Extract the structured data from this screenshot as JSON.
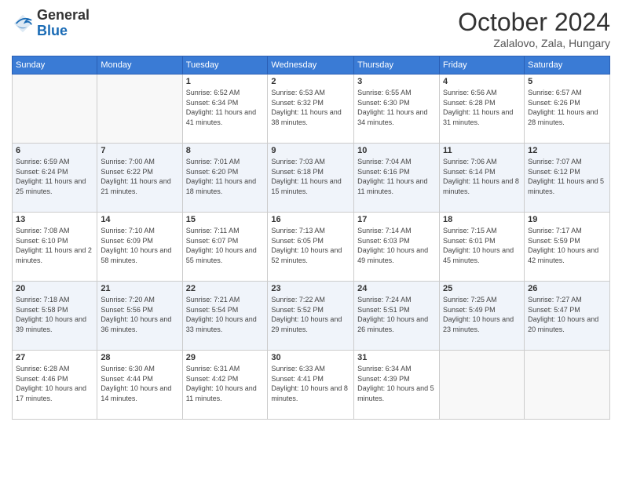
{
  "header": {
    "logo_general": "General",
    "logo_blue": "Blue",
    "month_title": "October 2024",
    "subtitle": "Zalalovo, Zala, Hungary"
  },
  "weekdays": [
    "Sunday",
    "Monday",
    "Tuesday",
    "Wednesday",
    "Thursday",
    "Friday",
    "Saturday"
  ],
  "weeks": [
    [
      {
        "day": "",
        "info": ""
      },
      {
        "day": "",
        "info": ""
      },
      {
        "day": "1",
        "info": "Sunrise: 6:52 AM\nSunset: 6:34 PM\nDaylight: 11 hours and 41 minutes."
      },
      {
        "day": "2",
        "info": "Sunrise: 6:53 AM\nSunset: 6:32 PM\nDaylight: 11 hours and 38 minutes."
      },
      {
        "day": "3",
        "info": "Sunrise: 6:55 AM\nSunset: 6:30 PM\nDaylight: 11 hours and 34 minutes."
      },
      {
        "day": "4",
        "info": "Sunrise: 6:56 AM\nSunset: 6:28 PM\nDaylight: 11 hours and 31 minutes."
      },
      {
        "day": "5",
        "info": "Sunrise: 6:57 AM\nSunset: 6:26 PM\nDaylight: 11 hours and 28 minutes."
      }
    ],
    [
      {
        "day": "6",
        "info": "Sunrise: 6:59 AM\nSunset: 6:24 PM\nDaylight: 11 hours and 25 minutes."
      },
      {
        "day": "7",
        "info": "Sunrise: 7:00 AM\nSunset: 6:22 PM\nDaylight: 11 hours and 21 minutes."
      },
      {
        "day": "8",
        "info": "Sunrise: 7:01 AM\nSunset: 6:20 PM\nDaylight: 11 hours and 18 minutes."
      },
      {
        "day": "9",
        "info": "Sunrise: 7:03 AM\nSunset: 6:18 PM\nDaylight: 11 hours and 15 minutes."
      },
      {
        "day": "10",
        "info": "Sunrise: 7:04 AM\nSunset: 6:16 PM\nDaylight: 11 hours and 11 minutes."
      },
      {
        "day": "11",
        "info": "Sunrise: 7:06 AM\nSunset: 6:14 PM\nDaylight: 11 hours and 8 minutes."
      },
      {
        "day": "12",
        "info": "Sunrise: 7:07 AM\nSunset: 6:12 PM\nDaylight: 11 hours and 5 minutes."
      }
    ],
    [
      {
        "day": "13",
        "info": "Sunrise: 7:08 AM\nSunset: 6:10 PM\nDaylight: 11 hours and 2 minutes."
      },
      {
        "day": "14",
        "info": "Sunrise: 7:10 AM\nSunset: 6:09 PM\nDaylight: 10 hours and 58 minutes."
      },
      {
        "day": "15",
        "info": "Sunrise: 7:11 AM\nSunset: 6:07 PM\nDaylight: 10 hours and 55 minutes."
      },
      {
        "day": "16",
        "info": "Sunrise: 7:13 AM\nSunset: 6:05 PM\nDaylight: 10 hours and 52 minutes."
      },
      {
        "day": "17",
        "info": "Sunrise: 7:14 AM\nSunset: 6:03 PM\nDaylight: 10 hours and 49 minutes."
      },
      {
        "day": "18",
        "info": "Sunrise: 7:15 AM\nSunset: 6:01 PM\nDaylight: 10 hours and 45 minutes."
      },
      {
        "day": "19",
        "info": "Sunrise: 7:17 AM\nSunset: 5:59 PM\nDaylight: 10 hours and 42 minutes."
      }
    ],
    [
      {
        "day": "20",
        "info": "Sunrise: 7:18 AM\nSunset: 5:58 PM\nDaylight: 10 hours and 39 minutes."
      },
      {
        "day": "21",
        "info": "Sunrise: 7:20 AM\nSunset: 5:56 PM\nDaylight: 10 hours and 36 minutes."
      },
      {
        "day": "22",
        "info": "Sunrise: 7:21 AM\nSunset: 5:54 PM\nDaylight: 10 hours and 33 minutes."
      },
      {
        "day": "23",
        "info": "Sunrise: 7:22 AM\nSunset: 5:52 PM\nDaylight: 10 hours and 29 minutes."
      },
      {
        "day": "24",
        "info": "Sunrise: 7:24 AM\nSunset: 5:51 PM\nDaylight: 10 hours and 26 minutes."
      },
      {
        "day": "25",
        "info": "Sunrise: 7:25 AM\nSunset: 5:49 PM\nDaylight: 10 hours and 23 minutes."
      },
      {
        "day": "26",
        "info": "Sunrise: 7:27 AM\nSunset: 5:47 PM\nDaylight: 10 hours and 20 minutes."
      }
    ],
    [
      {
        "day": "27",
        "info": "Sunrise: 6:28 AM\nSunset: 4:46 PM\nDaylight: 10 hours and 17 minutes."
      },
      {
        "day": "28",
        "info": "Sunrise: 6:30 AM\nSunset: 4:44 PM\nDaylight: 10 hours and 14 minutes."
      },
      {
        "day": "29",
        "info": "Sunrise: 6:31 AM\nSunset: 4:42 PM\nDaylight: 10 hours and 11 minutes."
      },
      {
        "day": "30",
        "info": "Sunrise: 6:33 AM\nSunset: 4:41 PM\nDaylight: 10 hours and 8 minutes."
      },
      {
        "day": "31",
        "info": "Sunrise: 6:34 AM\nSunset: 4:39 PM\nDaylight: 10 hours and 5 minutes."
      },
      {
        "day": "",
        "info": ""
      },
      {
        "day": "",
        "info": ""
      }
    ]
  ]
}
